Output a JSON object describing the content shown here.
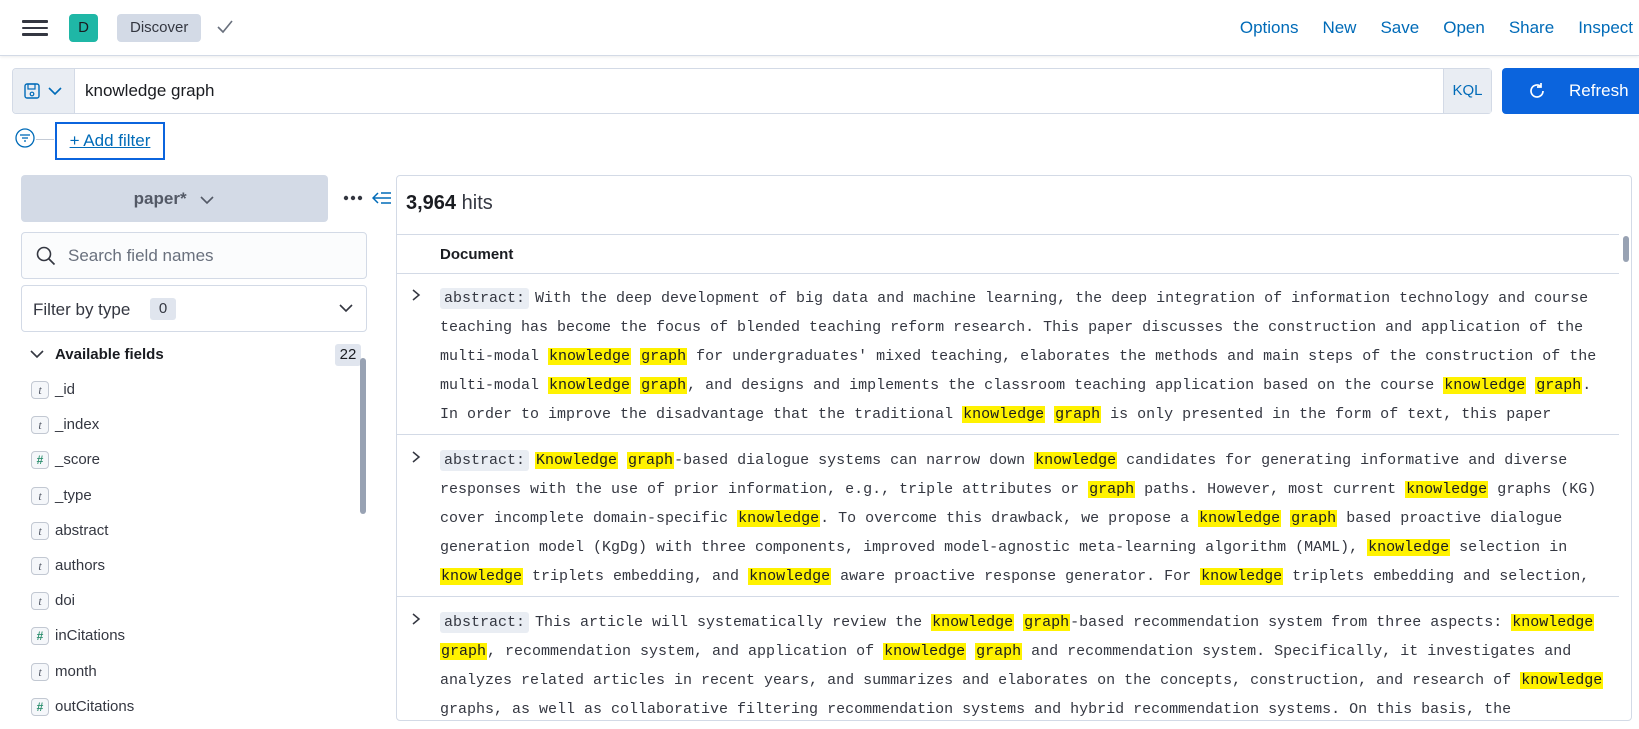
{
  "header": {
    "avatar_letter": "D",
    "breadcrumb": "Discover",
    "links": [
      "Options",
      "New",
      "Save",
      "Open",
      "Share",
      "Inspect"
    ]
  },
  "query": {
    "value": "knowledge graph",
    "language": "KQL",
    "refresh_label": "Refresh"
  },
  "filters": {
    "add_label": "+ Add filter"
  },
  "sidebar": {
    "index_pattern": "paper*",
    "search_placeholder": "Search field names",
    "filter_by_type": "Filter by type",
    "filter_count": "0",
    "available_fields_label": "Available fields",
    "available_fields_count": "22",
    "fields": [
      {
        "type": "t",
        "name": "_id"
      },
      {
        "type": "t",
        "name": "_index"
      },
      {
        "type": "#",
        "name": "_score"
      },
      {
        "type": "t",
        "name": "_type"
      },
      {
        "type": "t",
        "name": "abstract"
      },
      {
        "type": "t",
        "name": "authors"
      },
      {
        "type": "t",
        "name": "doi"
      },
      {
        "type": "#",
        "name": "inCitations"
      },
      {
        "type": "t",
        "name": "month"
      },
      {
        "type": "#",
        "name": "outCitations"
      }
    ]
  },
  "results": {
    "hits_count": "3,964",
    "hits_label": "hits",
    "column_header": "Document",
    "field_label": "abstract:",
    "rows": [
      "With the deep development of big data and machine learning, the deep integration of information technology and course teaching has become the focus of blended teaching reform research. This paper discusses the construction and application of the multi-modal [[knowledge]] [[graph]] for undergraduates' mixed teaching, elaborates the methods and main steps of the construction of the multi-modal [[knowledge]] [[graph]], and designs and implements the classroom teaching application based on the course [[knowledge]] [[graph]]. In order to improve the disadvantage that the traditional [[knowledge]] [[graph]] is only presented in the form of text, this paper focuses on collecting multi-",
      "[[Knowledge]] [[graph]]-based dialogue systems can narrow down [[knowledge]] candidates for generating informative and diverse responses with the use of prior information, e.g., triple attributes or [[graph]] paths. However, most current [[knowledge]] graphs (KG) cover incomplete domain-specific [[knowledge]]. To overcome this drawback, we propose a [[knowledge]] [[graph]] based proactive dialogue generation model (KgDg) with three components, improved model-agnostic meta-learning algorithm (MAML), [[knowledge]] selection in [[knowledge]] triplets embedding, and [[knowledge]] aware proactive response generator. For [[knowledge]] triplets embedding and selection, we formulate it as a problem of sentence",
      "This article will systematically review the [[knowledge]] [[graph]]-based recommendation system from three aspects: [[knowledge]] [[graph]], recommendation system, and application of [[knowledge]] [[graph]] and recommendation system. Specifically, it investigates and analyzes related articles in recent years, and summarizes and elaborates on the concepts, construction, and research of [[knowledge]] graphs, as well as collaborative filtering recommendation systems and hybrid recommendation systems. On this basis, the application scenarios of the"
    ]
  },
  "colors": {
    "accent": "#006bb8",
    "refresh_bg": "#0b64dd",
    "highlight": "#fff200",
    "avatar_bg": "#1fb7a6"
  }
}
